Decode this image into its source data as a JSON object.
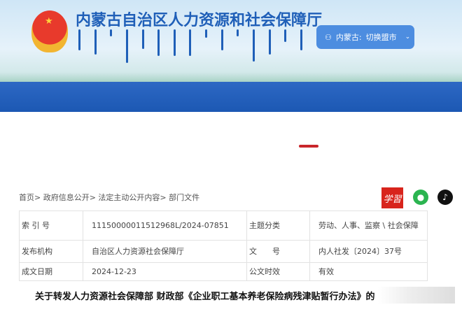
{
  "header": {
    "title": "内蒙古自治区人力资源和社会保障厅",
    "city_label": "内蒙古:",
    "city_switch": "切换盟市"
  },
  "breadcrumb": "首页> 政府信息公开> 法定主动公开内容> 部门文件",
  "icons": {
    "xuexi": "学習"
  },
  "meta": [
    [
      "索 引 号",
      "11150000011512968L/2024-07851",
      "主题分类",
      "劳动、人事、监察 \\ 社会保障"
    ],
    [
      "发布机构",
      "自治区人力资源社会保障厅",
      "文　　号",
      "内人社发〔2024〕37号"
    ],
    [
      "成文日期",
      "2024-12-23",
      "公文时效",
      "有效"
    ]
  ],
  "doc_title": "关于转发人力资源社会保障部 财政部《企业职工基本养老保险病残津贴暂行办法》的"
}
